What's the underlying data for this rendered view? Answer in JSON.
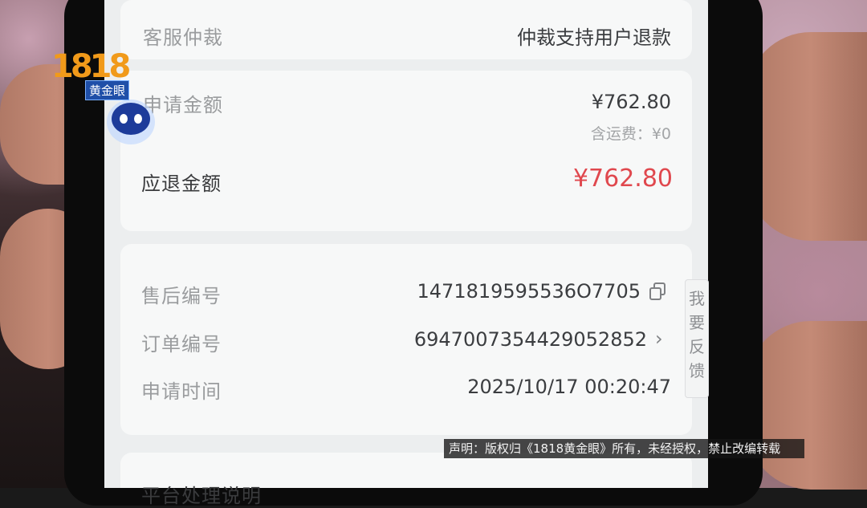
{
  "arbitration": {
    "label": "客服仲裁",
    "value": "仲裁支持用户退款"
  },
  "apply_amount": {
    "label": "申请金额",
    "value": "¥762.80",
    "shipping": "含运费：¥0"
  },
  "refund_amount": {
    "label": "应退金额",
    "value": "¥762.80"
  },
  "order_info": {
    "aftersale_label": "售后编号",
    "aftersale_value": "1471819595536O7705",
    "order_label": "订单编号",
    "order_value": "6947007354429052852",
    "time_label": "申请时间",
    "time_value": "2025/10/17 00:20:47"
  },
  "feedback_button": "我要反馈",
  "bottom_partial_label": "平台处理说明",
  "watermark": {
    "logo_numbers": "1818",
    "logo_text": "黄金眼",
    "disclaimer": "声明：版权归《1818黄金眼》所有，未经授权，禁止改编转载"
  },
  "colors": {
    "refund_red": "#e0484e",
    "label_gray": "#9a9c9e",
    "value_dark": "#3b3d40",
    "screen_bg": "#eceeef",
    "card_bg": "#f7f8f8"
  },
  "icons": {
    "copy": "copy-icon",
    "chevron": "chevron-right-icon",
    "assistant": "robot-assistant-icon"
  }
}
